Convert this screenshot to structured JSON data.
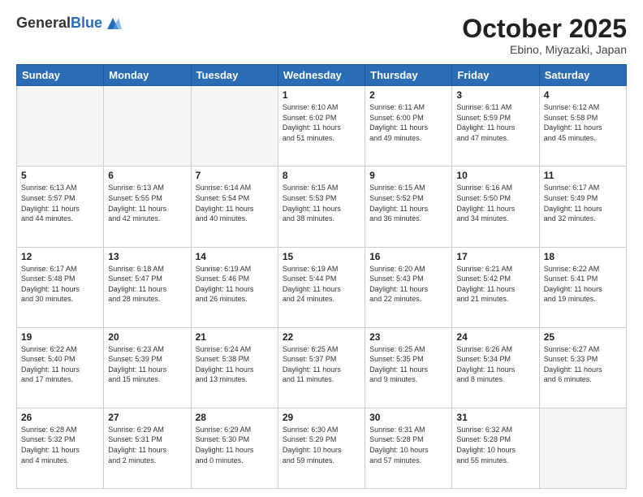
{
  "header": {
    "logo_general": "General",
    "logo_blue": "Blue",
    "month": "October 2025",
    "location": "Ebino, Miyazaki, Japan"
  },
  "weekdays": [
    "Sunday",
    "Monday",
    "Tuesday",
    "Wednesday",
    "Thursday",
    "Friday",
    "Saturday"
  ],
  "weeks": [
    [
      {
        "day": "",
        "info": ""
      },
      {
        "day": "",
        "info": ""
      },
      {
        "day": "",
        "info": ""
      },
      {
        "day": "1",
        "info": "Sunrise: 6:10 AM\nSunset: 6:02 PM\nDaylight: 11 hours\nand 51 minutes."
      },
      {
        "day": "2",
        "info": "Sunrise: 6:11 AM\nSunset: 6:00 PM\nDaylight: 11 hours\nand 49 minutes."
      },
      {
        "day": "3",
        "info": "Sunrise: 6:11 AM\nSunset: 5:59 PM\nDaylight: 11 hours\nand 47 minutes."
      },
      {
        "day": "4",
        "info": "Sunrise: 6:12 AM\nSunset: 5:58 PM\nDaylight: 11 hours\nand 45 minutes."
      }
    ],
    [
      {
        "day": "5",
        "info": "Sunrise: 6:13 AM\nSunset: 5:57 PM\nDaylight: 11 hours\nand 44 minutes."
      },
      {
        "day": "6",
        "info": "Sunrise: 6:13 AM\nSunset: 5:55 PM\nDaylight: 11 hours\nand 42 minutes."
      },
      {
        "day": "7",
        "info": "Sunrise: 6:14 AM\nSunset: 5:54 PM\nDaylight: 11 hours\nand 40 minutes."
      },
      {
        "day": "8",
        "info": "Sunrise: 6:15 AM\nSunset: 5:53 PM\nDaylight: 11 hours\nand 38 minutes."
      },
      {
        "day": "9",
        "info": "Sunrise: 6:15 AM\nSunset: 5:52 PM\nDaylight: 11 hours\nand 36 minutes."
      },
      {
        "day": "10",
        "info": "Sunrise: 6:16 AM\nSunset: 5:50 PM\nDaylight: 11 hours\nand 34 minutes."
      },
      {
        "day": "11",
        "info": "Sunrise: 6:17 AM\nSunset: 5:49 PM\nDaylight: 11 hours\nand 32 minutes."
      }
    ],
    [
      {
        "day": "12",
        "info": "Sunrise: 6:17 AM\nSunset: 5:48 PM\nDaylight: 11 hours\nand 30 minutes."
      },
      {
        "day": "13",
        "info": "Sunrise: 6:18 AM\nSunset: 5:47 PM\nDaylight: 11 hours\nand 28 minutes."
      },
      {
        "day": "14",
        "info": "Sunrise: 6:19 AM\nSunset: 5:46 PM\nDaylight: 11 hours\nand 26 minutes."
      },
      {
        "day": "15",
        "info": "Sunrise: 6:19 AM\nSunset: 5:44 PM\nDaylight: 11 hours\nand 24 minutes."
      },
      {
        "day": "16",
        "info": "Sunrise: 6:20 AM\nSunset: 5:43 PM\nDaylight: 11 hours\nand 22 minutes."
      },
      {
        "day": "17",
        "info": "Sunrise: 6:21 AM\nSunset: 5:42 PM\nDaylight: 11 hours\nand 21 minutes."
      },
      {
        "day": "18",
        "info": "Sunrise: 6:22 AM\nSunset: 5:41 PM\nDaylight: 11 hours\nand 19 minutes."
      }
    ],
    [
      {
        "day": "19",
        "info": "Sunrise: 6:22 AM\nSunset: 5:40 PM\nDaylight: 11 hours\nand 17 minutes."
      },
      {
        "day": "20",
        "info": "Sunrise: 6:23 AM\nSunset: 5:39 PM\nDaylight: 11 hours\nand 15 minutes."
      },
      {
        "day": "21",
        "info": "Sunrise: 6:24 AM\nSunset: 5:38 PM\nDaylight: 11 hours\nand 13 minutes."
      },
      {
        "day": "22",
        "info": "Sunrise: 6:25 AM\nSunset: 5:37 PM\nDaylight: 11 hours\nand 11 minutes."
      },
      {
        "day": "23",
        "info": "Sunrise: 6:25 AM\nSunset: 5:35 PM\nDaylight: 11 hours\nand 9 minutes."
      },
      {
        "day": "24",
        "info": "Sunrise: 6:26 AM\nSunset: 5:34 PM\nDaylight: 11 hours\nand 8 minutes."
      },
      {
        "day": "25",
        "info": "Sunrise: 6:27 AM\nSunset: 5:33 PM\nDaylight: 11 hours\nand 6 minutes."
      }
    ],
    [
      {
        "day": "26",
        "info": "Sunrise: 6:28 AM\nSunset: 5:32 PM\nDaylight: 11 hours\nand 4 minutes."
      },
      {
        "day": "27",
        "info": "Sunrise: 6:29 AM\nSunset: 5:31 PM\nDaylight: 11 hours\nand 2 minutes."
      },
      {
        "day": "28",
        "info": "Sunrise: 6:29 AM\nSunset: 5:30 PM\nDaylight: 11 hours\nand 0 minutes."
      },
      {
        "day": "29",
        "info": "Sunrise: 6:30 AM\nSunset: 5:29 PM\nDaylight: 10 hours\nand 59 minutes."
      },
      {
        "day": "30",
        "info": "Sunrise: 6:31 AM\nSunset: 5:28 PM\nDaylight: 10 hours\nand 57 minutes."
      },
      {
        "day": "31",
        "info": "Sunrise: 6:32 AM\nSunset: 5:28 PM\nDaylight: 10 hours\nand 55 minutes."
      },
      {
        "day": "",
        "info": ""
      }
    ]
  ]
}
